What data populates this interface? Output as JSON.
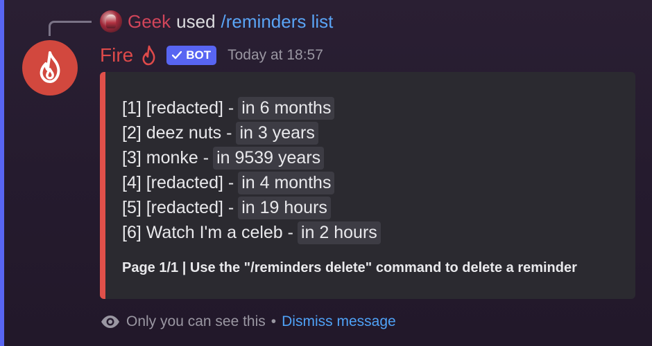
{
  "reply": {
    "user": "Geek",
    "used_text": "used",
    "command": "/reminders list",
    "avatar_icon": "user-avatar"
  },
  "message": {
    "author": "Fire",
    "bot_badge": "BOT",
    "timestamp": "Today at 18:57",
    "avatar_icon": "flame-icon"
  },
  "embed": {
    "accent_color": "#e0504a",
    "reminders": [
      {
        "label": "[1] [redacted] -",
        "when": "in 6 months"
      },
      {
        "label": "[2] deez nuts -",
        "when": "in 3 years"
      },
      {
        "label": "[3] monke -",
        "when": "in 9539 years"
      },
      {
        "label": "[4] [redacted] -",
        "when": "in 4 months"
      },
      {
        "label": "[5] [redacted] -",
        "when": "in 19 hours"
      },
      {
        "label": "[6] Watch I'm a celeb -",
        "when": "in 2 hours"
      }
    ],
    "footer": "Page 1/1 | Use the \"/reminders delete\" command to delete a reminder"
  },
  "ephemeral": {
    "notice": "Only you can see this",
    "separator": "•",
    "dismiss": "Dismiss message"
  },
  "colors": {
    "blurple": "#5865f2",
    "link": "#4fa2f7",
    "username_red": "#de4a4a"
  }
}
